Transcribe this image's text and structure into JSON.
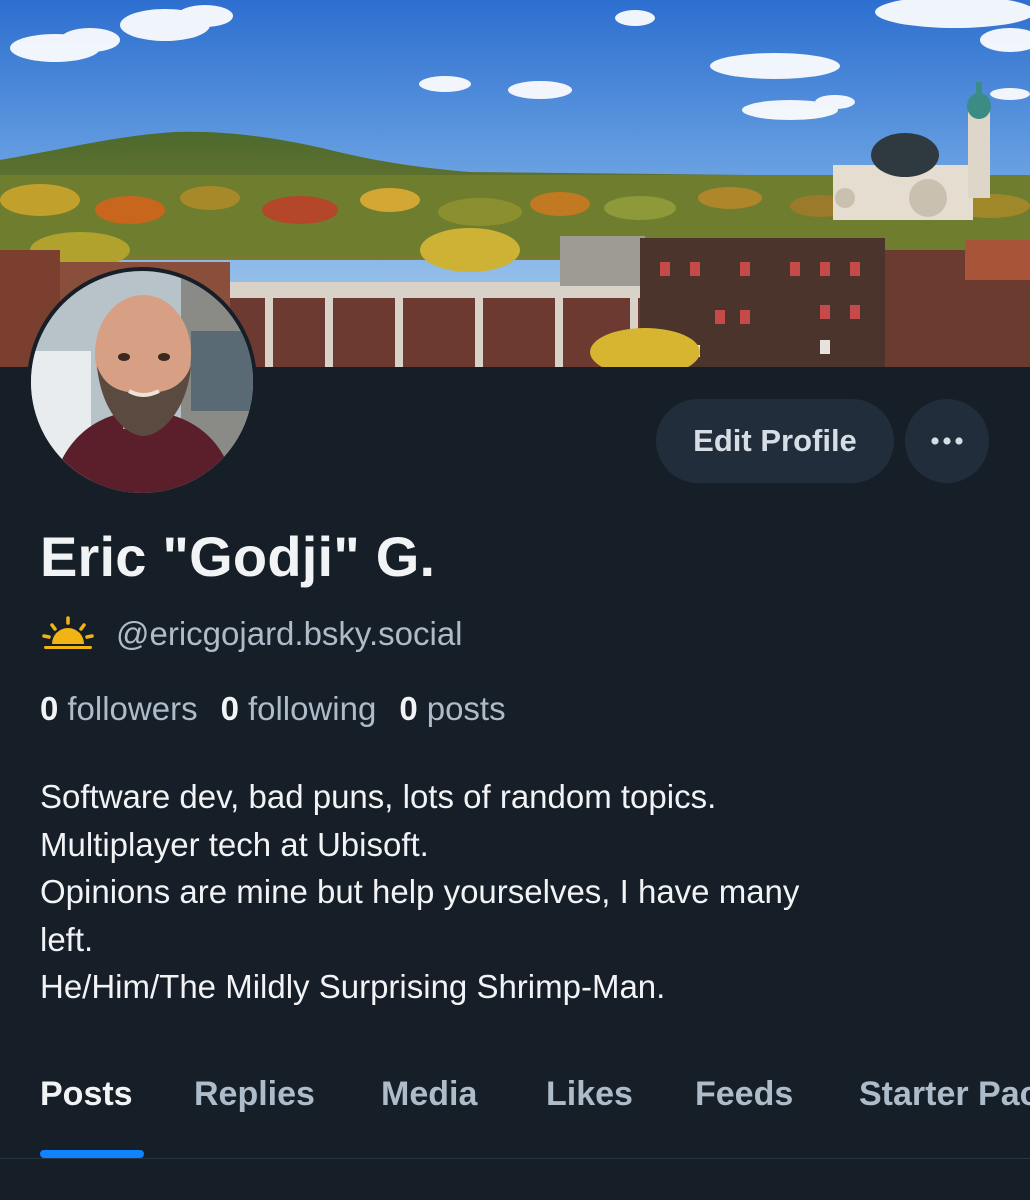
{
  "profile": {
    "display_name": "Eric \"Godji\" G.",
    "handle": "@ericgojard.bsky.social",
    "handle_icon": "sun-emoji-icon"
  },
  "actions": {
    "edit_label": "Edit Profile",
    "more_icon": "ellipsis-icon"
  },
  "stats": [
    {
      "count": "0",
      "label": "followers"
    },
    {
      "count": "0",
      "label": "following"
    },
    {
      "count": "0",
      "label": "posts"
    }
  ],
  "bio": [
    "Software dev, bad puns, lots of random topics.",
    "Multiplayer tech at Ubisoft.",
    "Opinions are mine but help yourselves, I have many",
    "left.",
    "He/Him/The Mildly Surprising Shrimp-Man."
  ],
  "tabs": [
    {
      "label": "Posts",
      "active": true
    },
    {
      "label": "Replies",
      "active": false
    },
    {
      "label": "Media",
      "active": false
    },
    {
      "label": "Likes",
      "active": false
    },
    {
      "label": "Feeds",
      "active": false
    },
    {
      "label": "Starter Packs",
      "active": false
    }
  ],
  "colors": {
    "background": "#161e27",
    "button_bg": "#212d3b",
    "muted_text": "#aebbc9",
    "accent": "#1083fe"
  }
}
